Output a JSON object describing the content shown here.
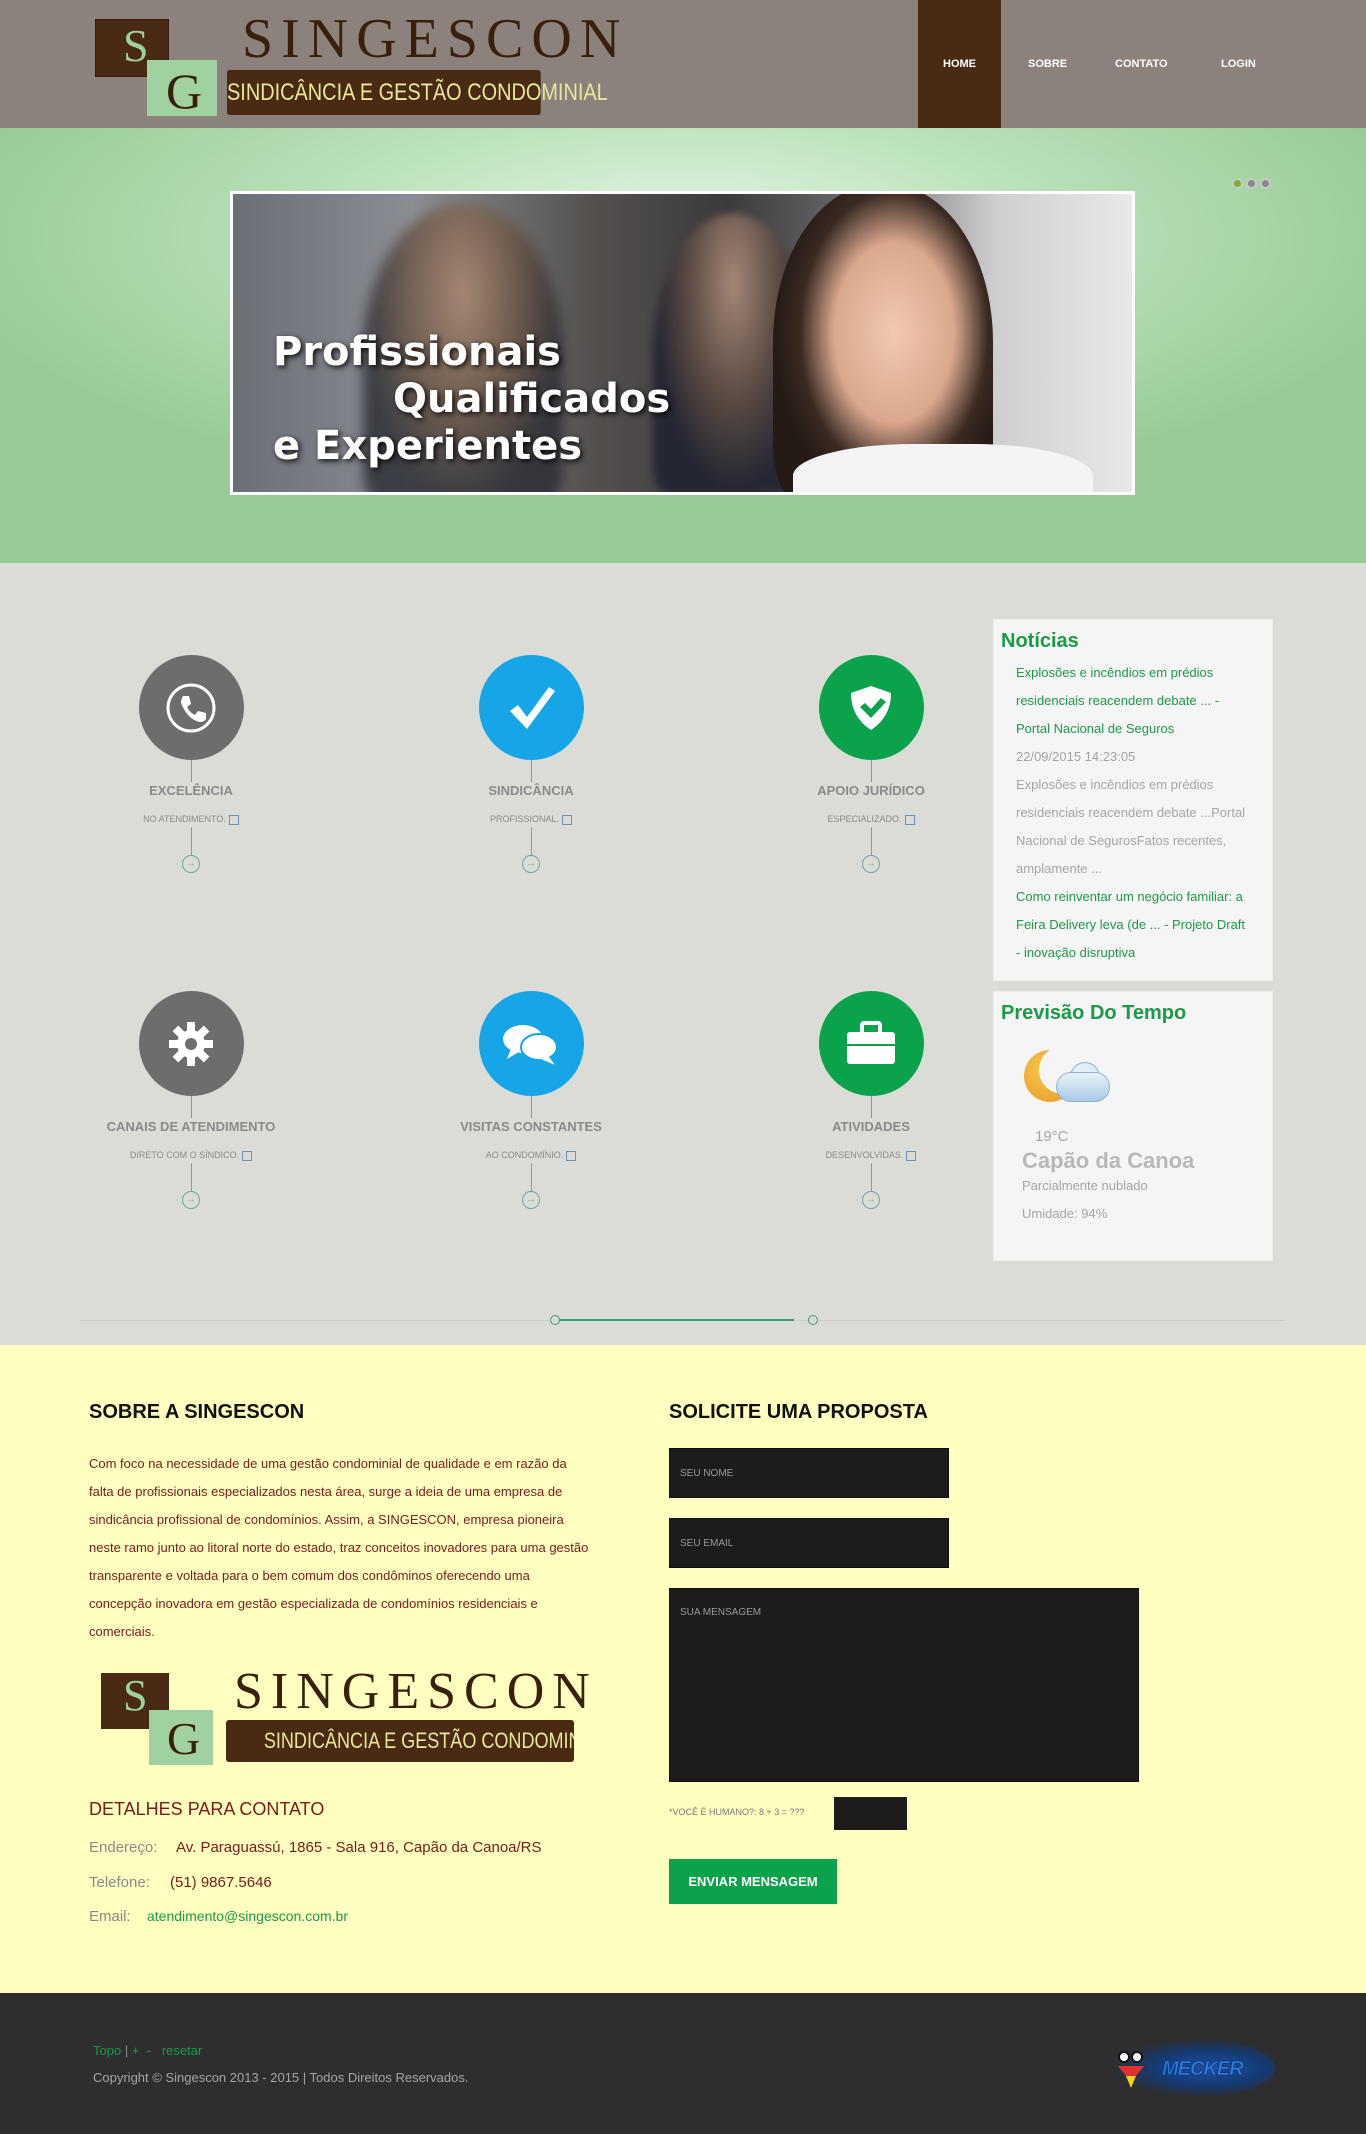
{
  "header": {
    "logo": {
      "s": "S",
      "g": "G",
      "brand": "SINGESCON",
      "tagline": "SINDICÂNCIA E GESTÃO CONDOMINIAL"
    },
    "nav": [
      "HOME",
      "SOBRE",
      "CONTATO",
      "LOGIN"
    ],
    "active_nav": "HOME"
  },
  "hero": {
    "line1": "Profissionais",
    "line2": "Qualificados",
    "line3": "e Experientes",
    "slide_count": 3,
    "active_slide": 1
  },
  "features": [
    {
      "title": "EXCELÊNCIA",
      "sub": "NO ATENDIMENTO.",
      "icon": "phone-icon",
      "color": "#6d6d6d"
    },
    {
      "title": "SINDICÂNCIA",
      "sub": "PROFISSIONAL.",
      "icon": "checkmark-icon",
      "color": "#16a6e8"
    },
    {
      "title": "APOIO JURÍDICO",
      "sub": "ESPECIALIZADO.",
      "icon": "shield-check-icon",
      "color": "#0aa24a"
    },
    {
      "title": "CANAIS DE ATENDIMENTO",
      "sub": "DIRETO COM O SÍNDICO.",
      "icon": "gear-icon",
      "color": "#6d6d6d"
    },
    {
      "title": "VISITAS CONSTANTES",
      "sub": "AO CONDOMÍNIO.",
      "icon": "chat-bubbles-icon",
      "color": "#16a6e8"
    },
    {
      "title": "ATIVIDADES",
      "sub": "DESENVOLVIDAS.",
      "icon": "briefcase-icon",
      "color": "#0aa24a"
    }
  ],
  "news": {
    "title": "Notícias",
    "items": [
      {
        "type": "link",
        "text": "Explosões e incêndios em prédios residenciais reacendem debate ... - Portal Nacional de Seguros"
      },
      {
        "type": "muted",
        "text": "22/09/2015 14:23:05"
      },
      {
        "type": "muted",
        "text": "Explosões e incêndios em prédios residenciais reacendem debate ...Portal Nacional de SegurosFatos recentes, amplamente ..."
      },
      {
        "type": "link",
        "text": "Como reinventar um negócio familiar: a Feira Delivery leva (de ... - Projeto Draft - inovação disruptiva"
      }
    ]
  },
  "weather": {
    "title": "Previsão Do Tempo",
    "temp": "19°C",
    "city": "Capão da Canoa",
    "condition": "Parcialmente nublado",
    "humidity": "Umidade: 94%"
  },
  "about": {
    "title": "SOBRE A SINGESCON",
    "text": "Com foco na necessidade de uma gestão condominial de qualidade e em razão da falta de profissionais especializados nesta área, surge a ideia de uma empresa de sindicância profissional de condomínios. Assim, a SINGESCON, empresa pioneira neste ramo junto ao litoral norte do estado, traz conceitos inovadores para uma gestão transparente e voltada para o bem comum dos condôminos oferecendo uma concepção inovadora em gestão especializada de condomínios residenciais e comerciais.",
    "contact_title": "DETALHES PARA CONTATO",
    "address_label": "Endereço:",
    "address": "Av. Paraguassú, 1865 - Sala 916, Capão da Canoa/RS",
    "phone_label": "Telefone:",
    "phone": "(51) 9867.5646",
    "email_label": "Email:",
    "email": "atendimento@singescon.com.br"
  },
  "form": {
    "title": "SOLICITE UMA PROPOSTA",
    "name_placeholder": "SEU NOME",
    "email_placeholder": "SEU EMAIL",
    "message_placeholder": "SUA MENSAGEM",
    "captcha": "*VOCÊ É HUMANO?: 8 + 3 = ???",
    "submit": "ENVIAR MENSAGEM"
  },
  "footer": {
    "topo": "Topo",
    "plus": "+",
    "minus": "-",
    "reset": "resetar",
    "copyright": "Copyright © Singescon 2013 - 2015 | Todos Direitos Reservados.",
    "partner_logo": "MECKER"
  }
}
